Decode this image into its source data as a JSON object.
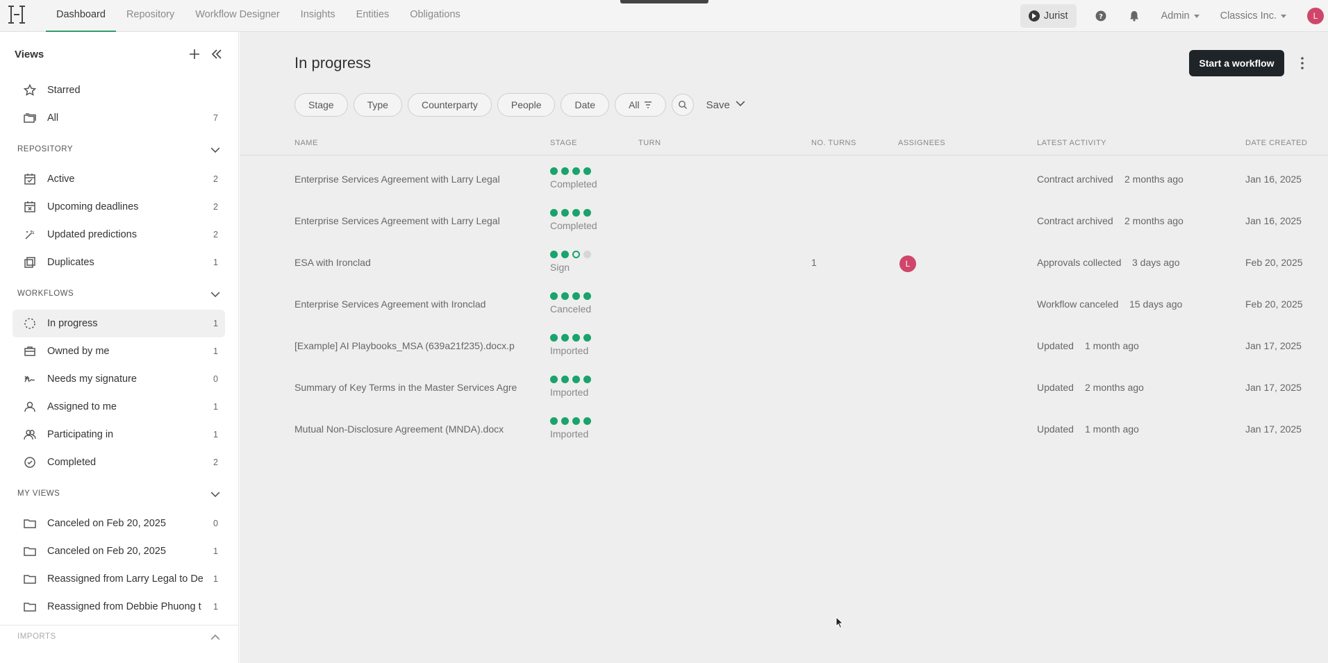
{
  "nav": {
    "tabs": [
      "Dashboard",
      "Repository",
      "Workflow Designer",
      "Insights",
      "Entities",
      "Obligations"
    ],
    "active_tab": "Dashboard",
    "jurist_label": "Jurist",
    "admin_label": "Admin",
    "org_label": "Classics Inc.",
    "avatar_initial": "L"
  },
  "sidebar": {
    "views_title": "Views",
    "top_items": [
      {
        "label": "Starred",
        "count": "",
        "icon": "star-icon"
      },
      {
        "label": "All",
        "count": "7",
        "icon": "folders-icon"
      }
    ],
    "repository_title": "REPOSITORY",
    "repository_items": [
      {
        "label": "Active",
        "count": "2",
        "icon": "calendar-check-icon"
      },
      {
        "label": "Upcoming deadlines",
        "count": "2",
        "icon": "calendar-x-icon"
      },
      {
        "label": "Updated predictions",
        "count": "2",
        "icon": "magic-wand-icon"
      },
      {
        "label": "Duplicates",
        "count": "1",
        "icon": "copy-icon"
      }
    ],
    "workflows_title": "WORKFLOWS",
    "workflow_items": [
      {
        "label": "In progress",
        "count": "1",
        "icon": "dashed-circle-icon"
      },
      {
        "label": "Owned by me",
        "count": "1",
        "icon": "briefcase-icon"
      },
      {
        "label": "Needs my signature",
        "count": "0",
        "icon": "signature-icon"
      },
      {
        "label": "Assigned to me",
        "count": "1",
        "icon": "user-icon"
      },
      {
        "label": "Participating in",
        "count": "1",
        "icon": "users-icon"
      },
      {
        "label": "Completed",
        "count": "2",
        "icon": "check-circle-icon"
      }
    ],
    "my_views_title": "MY VIEWS",
    "my_view_items": [
      {
        "label": "Canceled on Feb 20, 2025",
        "count": "0",
        "icon": "folder-icon"
      },
      {
        "label": "Canceled on Feb 20, 2025",
        "count": "1",
        "icon": "folder-icon"
      },
      {
        "label": "Reassigned from Larry Legal to De",
        "count": "1",
        "icon": "folder-icon"
      },
      {
        "label": "Reassigned from Debbie Phuong t",
        "count": "1",
        "icon": "folder-icon"
      }
    ],
    "imports_title": "IMPORTS"
  },
  "main": {
    "title": "In progress",
    "start_button": "Start a workflow",
    "filters": [
      "Stage",
      "Type",
      "Counterparty",
      "People",
      "Date"
    ],
    "all_filter": "All",
    "save_label": "Save",
    "columns": [
      "NAME",
      "STAGE",
      "TURN",
      "NO. TURNS",
      "ASSIGNEES",
      "LATEST ACTIVITY",
      "DATE CREATED"
    ],
    "rows": [
      {
        "name": "Enterprise Services Agreement with Larry Legal",
        "stage": "Completed",
        "dots": [
          2,
          2,
          2,
          2
        ],
        "turns": "",
        "assignee": "",
        "activity": "Contract archived",
        "when": "2 months ago",
        "created": "Jan 16, 2025"
      },
      {
        "name": "Enterprise Services Agreement with Larry Legal",
        "stage": "Completed",
        "dots": [
          2,
          2,
          2,
          2
        ],
        "turns": "",
        "assignee": "",
        "activity": "Contract archived",
        "when": "2 months ago",
        "created": "Jan 16, 2025"
      },
      {
        "name": "ESA with Ironclad",
        "stage": "Sign",
        "dots": [
          2,
          2,
          1,
          0
        ],
        "turns": "1",
        "assignee": "L",
        "activity": "Approvals collected",
        "when": "3 days ago",
        "created": "Feb 20, 2025"
      },
      {
        "name": "Enterprise Services Agreement with Ironclad",
        "stage": "Canceled",
        "dots": [
          2,
          2,
          2,
          2
        ],
        "turns": "",
        "assignee": "",
        "activity": "Workflow canceled",
        "when": "15 days ago",
        "created": "Feb 20, 2025"
      },
      {
        "name": "[Example] AI Playbooks_MSA (639a21f235).docx.p",
        "stage": "Imported",
        "dots": [
          2,
          2,
          2,
          2
        ],
        "turns": "",
        "assignee": "",
        "activity": "Updated",
        "when": "1 month ago",
        "created": "Jan 17, 2025"
      },
      {
        "name": "Summary of Key Terms in the Master Services Agre",
        "stage": "Imported",
        "dots": [
          2,
          2,
          2,
          2
        ],
        "turns": "",
        "assignee": "",
        "activity": "Updated",
        "when": "2 months ago",
        "created": "Jan 17, 2025"
      },
      {
        "name": "Mutual Non-Disclosure Agreement (MNDA).docx",
        "stage": "Imported",
        "dots": [
          2,
          2,
          2,
          2
        ],
        "turns": "",
        "assignee": "",
        "activity": "Updated",
        "when": "1 month ago",
        "created": "Jan 17, 2025"
      }
    ]
  }
}
